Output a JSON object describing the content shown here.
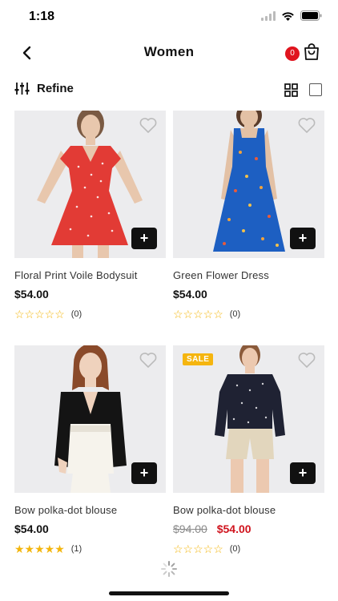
{
  "status_bar": {
    "time": "1:18"
  },
  "nav": {
    "title": "Women",
    "cart_count": "0"
  },
  "toolbar": {
    "refine_label": "Refine"
  },
  "colors": {
    "accent_red": "#e0141e",
    "star_yellow": "#f3b60e",
    "sale_badge": "#f5b50f"
  },
  "products": [
    {
      "name": "Floral Print Voile Bodysuit",
      "price": "$54.00",
      "old_price": "",
      "sale_badge": "",
      "stars": "☆☆☆☆☆",
      "rating_count": "(0)"
    },
    {
      "name": "Green Flower Dress",
      "price": "$54.00",
      "old_price": "",
      "sale_badge": "",
      "stars": "☆☆☆☆☆",
      "rating_count": "(0)"
    },
    {
      "name": "Bow polka-dot blouse",
      "price": "$54.00",
      "old_price": "",
      "sale_badge": "",
      "stars": "★★★★★",
      "rating_count": "(1)"
    },
    {
      "name": "Bow polka-dot blouse",
      "price": "$54.00",
      "old_price": "$94.00",
      "sale_badge": "SALE",
      "stars": "☆☆☆☆☆",
      "rating_count": "(0)"
    }
  ]
}
